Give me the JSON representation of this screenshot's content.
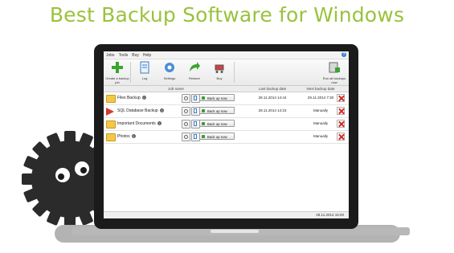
{
  "headline": "Best Backup Software for Windows",
  "menu": [
    "Jobs",
    "Tools",
    "Buy",
    "Help"
  ],
  "help_icon": "?",
  "toolbar": {
    "create_label": "Create a backup job",
    "log_label": "Log",
    "settings_label": "Settings",
    "restore_label": "Restore",
    "buy_label": "Buy",
    "run_all_label": "Run all backups now"
  },
  "table": {
    "columns": {
      "name": "Job name",
      "last": "Last backup date",
      "next": "Next backup date"
    },
    "backup_button_label": "Back up now",
    "info_glyph": "i",
    "rows": [
      {
        "name": "Files Backup",
        "last": "28.11.2014 14:44",
        "next": "29.11.2014 7:30",
        "icon": "folder-icon"
      },
      {
        "name": "SQL Database Backup",
        "last": "28.11.2014 14:23",
        "next": "Manually",
        "icon": "database-arrow-icon"
      },
      {
        "name": "Important Documents",
        "last": "",
        "next": "Manually",
        "icon": "folder-icon"
      },
      {
        "name": "Photos",
        "last": "",
        "next": "Manually",
        "icon": "folder-icon"
      }
    ]
  },
  "status": {
    "datetime": "28.11.2014 15:00"
  },
  "colors": {
    "headline": "#9ac23c",
    "laptop": "#1b1b1b",
    "gear": "#2b2b2b",
    "delete": "#d42a22"
  }
}
